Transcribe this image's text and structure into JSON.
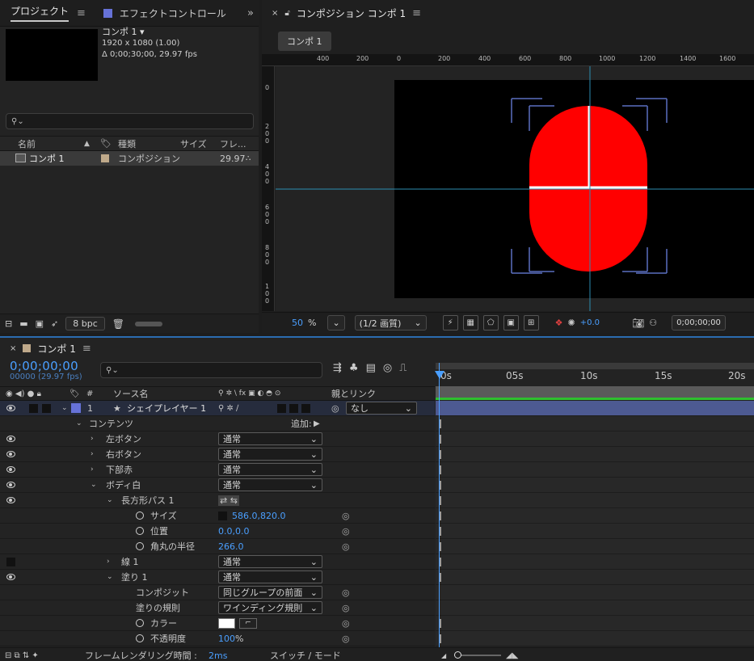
{
  "project": {
    "tab_project": "プロジェクト",
    "tab_effects": "エフェクトコントロール",
    "comp_name": "コンポ 1 ▾",
    "resolution": "1920 x 1080 (1.00)",
    "duration": "Δ 0;00;30;00, 29.97 fps",
    "columns": [
      "名前",
      "種類",
      "サイズ",
      "フレ..."
    ],
    "item": {
      "name": "コンポ 1",
      "type": "コンポジション",
      "fps": "29.97"
    },
    "bpc": "8 bpc"
  },
  "viewer": {
    "tab_title": "コンポジション コンポ 1",
    "chip": "コンポ 1",
    "ruler_top": [
      "400",
      "200",
      "0",
      "200",
      "400",
      "600",
      "800",
      "1000",
      "1200",
      "1400",
      "1600"
    ],
    "ruler_left": [
      "0",
      "2\n0\n0",
      "4\n0\n0",
      "6\n0\n0",
      "8\n0\n0",
      "1\n0\n0"
    ],
    "zoom_value": "50",
    "zoom_unit": "%",
    "quality": "(1/2 画質)",
    "exposure": "+0.0",
    "timecode": "0;00;00;00",
    "shape_color": "#ff0000"
  },
  "timeline": {
    "tab": "コンポ 1",
    "timecode": "0;00;00;00",
    "frames": "00000 (29.97 fps)",
    "col_source": "ソース名",
    "col_parent": "親とリンク",
    "col_switches": "⚲ ✲ \\ fx ▣ ◐ ◓ ⊙",
    "time_marks": [
      "0s",
      "05s",
      "10s",
      "15s",
      "20s"
    ],
    "layer": {
      "num": "1",
      "name": "シェイプレイヤー 1",
      "parent": "なし"
    },
    "contents": "コンテンツ",
    "add": "追加:",
    "rows": [
      {
        "name": "左ボタン",
        "mode": "通常"
      },
      {
        "name": "右ボタン",
        "mode": "通常"
      },
      {
        "name": "下部赤",
        "mode": "通常"
      },
      {
        "name": "ボディ白",
        "mode": "通常"
      }
    ],
    "rect_path": "長方形パス 1",
    "size_label": "サイズ",
    "size_value": "586.0,820.0",
    "pos_label": "位置",
    "pos_value": "0.0,0.0",
    "round_label": "角丸の半径",
    "round_value": "266.0",
    "stroke": {
      "name": "線 1",
      "mode": "通常"
    },
    "fill": {
      "name": "塗り 1",
      "mode": "通常"
    },
    "composite_label": "コンポジット",
    "composite_value": "同じグループの前面",
    "rule_label": "塗りの規則",
    "rule_value": "ワインディング規則",
    "color_label": "カラー",
    "opacity_label": "不透明度",
    "opacity_value": "100",
    "opacity_unit": "%",
    "render_time_label": "フレームレンダリング時間 :",
    "render_time_value": "2ms",
    "switch_mode": "スイッチ / モード"
  }
}
